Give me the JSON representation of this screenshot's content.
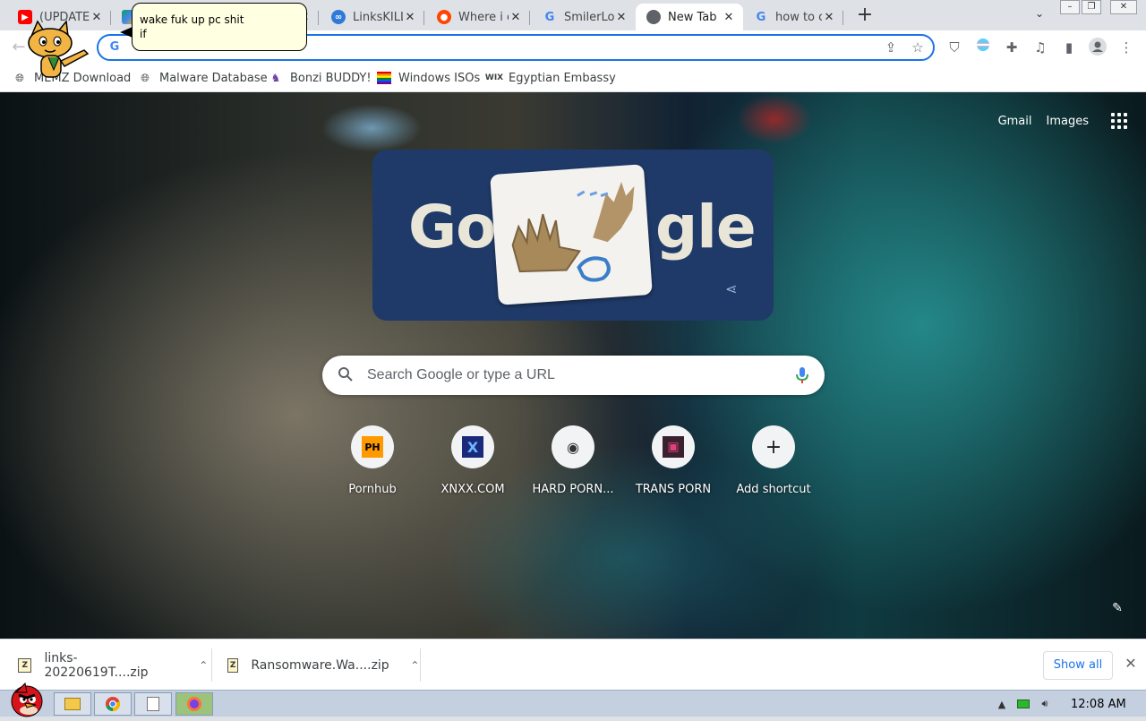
{
  "browser": {
    "tabs": [
      {
        "title": "(UPDATE",
        "favicon": "youtube-icon"
      },
      {
        "title": "",
        "favicon": "drive-icon"
      },
      {
        "title": "LinksKILL",
        "favicon": "links-icon"
      },
      {
        "title": "Where i c",
        "favicon": "reddit-icon"
      },
      {
        "title": "SmilerLo",
        "favicon": "google-icon"
      },
      {
        "title": "New Tab",
        "favicon": "chrome-icon"
      },
      {
        "title": "how to c",
        "favicon": "google-icon"
      }
    ],
    "new_tab_symbol": "+",
    "omnibox": {
      "value": "",
      "placeholder": ""
    },
    "bookmarks": [
      {
        "label": "MEMZ Download",
        "icon": "globe-icon"
      },
      {
        "label": "Malware Database",
        "icon": "globe-icon"
      },
      {
        "label": "Bonzi BUDDY!",
        "icon": "bonzi-icon"
      },
      {
        "label": "Windows ISOs",
        "icon": "rainbow-flag-icon"
      },
      {
        "label": "Egyptian Embassy",
        "icon": "wix-icon"
      }
    ]
  },
  "newtab": {
    "top_links": [
      "Gmail",
      "Images"
    ],
    "doodle": {
      "left_letters": "Go",
      "right_letters": "gle"
    },
    "search": {
      "placeholder": "Search Google or type a URL"
    },
    "shortcuts": [
      {
        "label": "Pornhub",
        "glyph": "PH"
      },
      {
        "label": "XNXX.COM",
        "glyph": "X"
      },
      {
        "label": "HARD PORN...",
        "glyph": "◉"
      },
      {
        "label": "TRANS PORN",
        "glyph": "▣"
      },
      {
        "label": "Add shortcut",
        "glyph": "+"
      }
    ]
  },
  "bonzi": {
    "message_line1": "wake fuk up pc shit",
    "message_line2": "if"
  },
  "downloads": {
    "items": [
      {
        "name": "links-20220619T....zip"
      },
      {
        "name": "Ransomware.Wa....zip"
      }
    ],
    "show_all": "Show all"
  },
  "taskbar": {
    "clock": "12:08 AM"
  },
  "colors": {
    "accent": "#1a73e8",
    "doodle_bg": "#1f3a68",
    "download_bubble": "#ffffe1",
    "taskbar": "#c4cfe0"
  }
}
